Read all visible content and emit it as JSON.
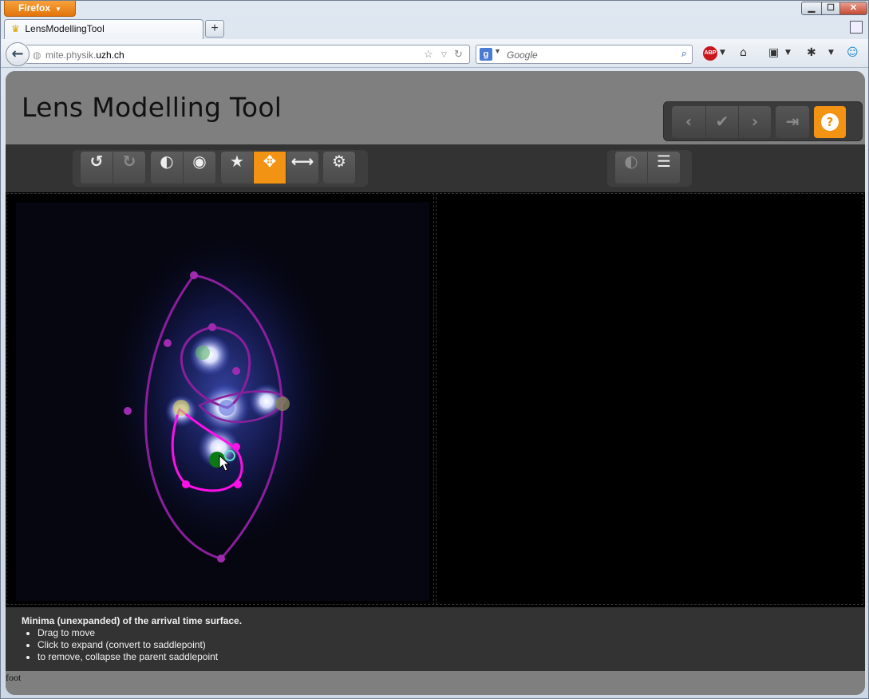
{
  "browser": {
    "menu_button": "Firefox",
    "tab_title": "LensModellingTool",
    "url_prefix": "mite.physik.",
    "url_domain": "uzh.ch",
    "search_placeholder": "Google",
    "search_engine_icon": "google-icon",
    "window_controls": {
      "minimize": "▁",
      "maximize": "☐",
      "close": "✕"
    }
  },
  "app": {
    "title": "Lens Modelling Tool",
    "colors": {
      "accent": "#f39313",
      "panel": "#333333",
      "header": "#7f7f7f"
    }
  },
  "toolbar": {
    "left_groups": [
      [
        "undo-icon",
        "redo-icon"
      ],
      [
        "contrast-icon",
        "eye-icon"
      ],
      [
        "star-icon",
        "move-icon",
        "resize-horizontal-icon"
      ],
      [
        "settings-icon"
      ]
    ],
    "active_tool": "move-icon",
    "right_group": [
      "contrast-icon",
      "list-icon"
    ],
    "nav_group": [
      "chevron-left-icon",
      "check-icon",
      "chevron-right-icon",
      "sign-in-icon",
      "help-icon"
    ]
  },
  "help": {
    "heading": "Minima (unexpanded) of the arrival time surface.",
    "items": [
      "Drag to move",
      "Click to expand (convert to saddlepoint)",
      "to remove, collapse the parent saddlepoint"
    ]
  },
  "footer": {
    "text": "foot"
  }
}
